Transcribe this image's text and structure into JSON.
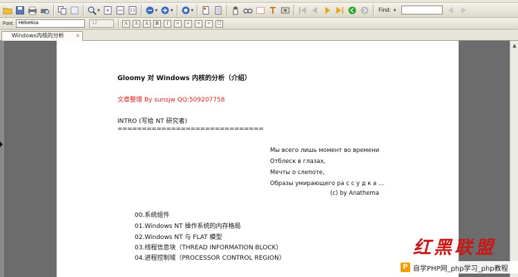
{
  "toolbar": {
    "find_label": "Find:",
    "find_value": ""
  },
  "format_bar": {
    "font_label": "Font:",
    "font_value": "Helvetica",
    "size_value": "12"
  },
  "tab": {
    "label": "Windows内核的分析",
    "close": "×"
  },
  "document": {
    "title": "Gloomy 对 Windows 内核的分析（介绍）",
    "author_line": "文章整理  By sunsjw  QQ:509207758",
    "intro": "INTRO (写给 NT 研究者)",
    "rule": "==============================",
    "russian": [
      "Мы всего лишь момент     во времени",
      "Отблеск в глазах,",
      "Мечты о слепоте,",
      "Образы умирающего ра с с у д к а ...",
      "(c) by Anathema"
    ],
    "toc": [
      "00.系统组件",
      "01.Windows NT 操作系统的内存格局",
      "02.Windows NT 与 FLAT 模型",
      "03.线程信息块（THREAD INFORMATION BLOCK）",
      "04.进程控制域（PROCESSOR CONTROL REGION）"
    ]
  },
  "watermark": {
    "brand": "红黑联盟",
    "logo_letter": "P",
    "bar_text": "自学PHP网_php学习_php教程"
  },
  "colors": {
    "author_red": "#cc2222",
    "watermark_red": "#c81818",
    "background_gray": "#6c6c6c"
  }
}
